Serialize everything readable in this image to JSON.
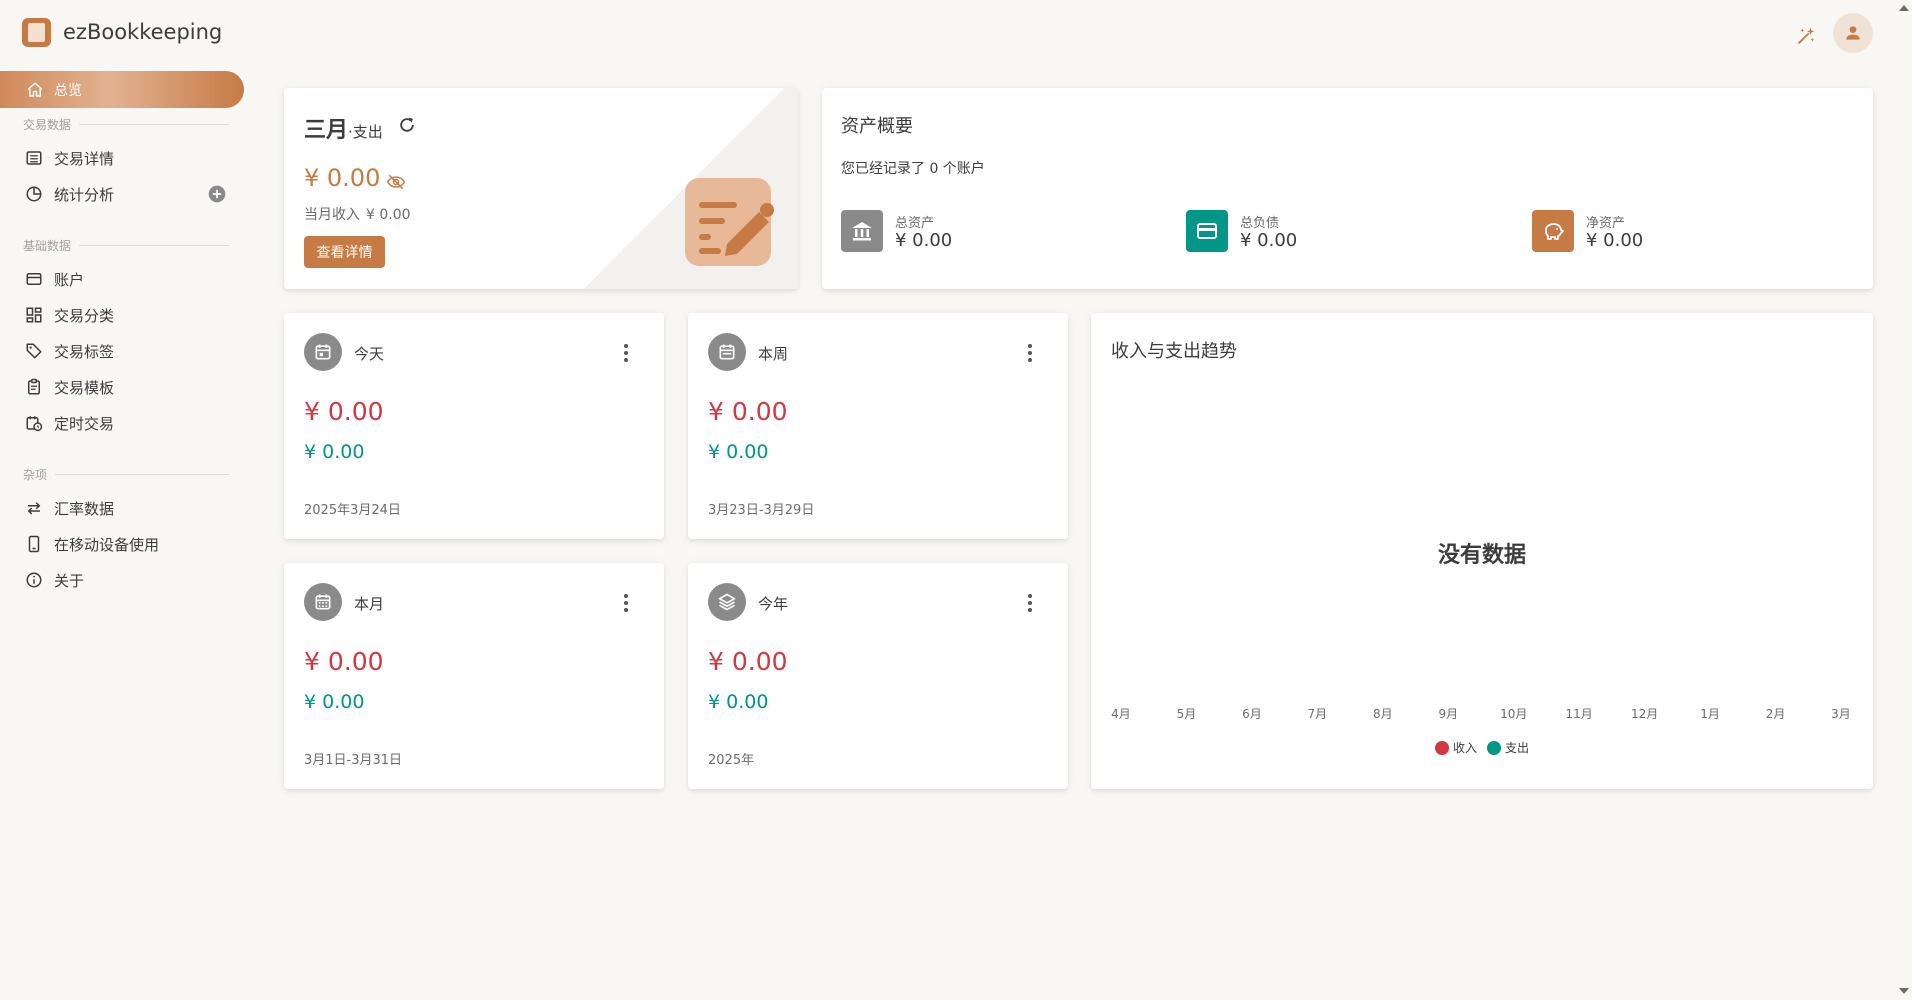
{
  "app": {
    "title": "ezBookkeeping"
  },
  "topbar": {
    "theme_icon": "magic-wand-icon",
    "avatar_icon": "user-icon"
  },
  "sidebar": {
    "active": {
      "label": "总览",
      "icon": "home-icon"
    },
    "sections": [
      {
        "title": "交易数据",
        "items": [
          {
            "label": "交易详情",
            "icon": "list-icon"
          },
          {
            "label": "统计分析",
            "icon": "pie-chart-icon"
          }
        ]
      },
      {
        "title": "基础数据",
        "items": [
          {
            "label": "账户",
            "icon": "credit-card-icon"
          },
          {
            "label": "交易分类",
            "icon": "grid-icon"
          },
          {
            "label": "交易标签",
            "icon": "tag-icon"
          },
          {
            "label": "交易模板",
            "icon": "clipboard-icon"
          },
          {
            "label": "定时交易",
            "icon": "calendar-clock-icon"
          }
        ]
      },
      {
        "title": "杂项",
        "items": [
          {
            "label": "汇率数据",
            "icon": "swap-icon"
          },
          {
            "label": "在移动设备使用",
            "icon": "phone-icon"
          },
          {
            "label": "关于",
            "icon": "info-icon"
          }
        ]
      }
    ]
  },
  "month_card": {
    "title": "三月",
    "subtitle": "·支出",
    "amount": "¥ 0.00",
    "income_label": "当月收入",
    "income_value": "¥ 0.00",
    "button": "查看详情"
  },
  "asset_card": {
    "title": "资产概要",
    "subtitle": "您已经记录了 0 个账户",
    "items": [
      {
        "label": "总资产",
        "value": "¥ 0.00",
        "color": "#8a8a8a",
        "icon": "bank-icon"
      },
      {
        "label": "总负债",
        "value": "¥ 0.00",
        "color": "#009688",
        "icon": "credit-card-icon"
      },
      {
        "label": "净资产",
        "value": "¥ 0.00",
        "color": "#c67b45",
        "icon": "piggy-bank-icon"
      }
    ]
  },
  "stats": [
    {
      "title": "今天",
      "expense": "¥ 0.00",
      "income": "¥ 0.00",
      "date": "2025年3月24日",
      "icon": "calendar-today-icon"
    },
    {
      "title": "本周",
      "expense": "¥ 0.00",
      "income": "¥ 0.00",
      "date": "3月23日-3月29日",
      "icon": "calendar-week-icon"
    },
    {
      "title": "本月",
      "expense": "¥ 0.00",
      "income": "¥ 0.00",
      "date": "3月1日-3月31日",
      "icon": "calendar-month-icon"
    },
    {
      "title": "今年",
      "expense": "¥ 0.00",
      "income": "¥ 0.00",
      "date": "2025年",
      "icon": "layers-icon"
    }
  ],
  "colors": {
    "accent": "#c67b45",
    "expense": "#d4373f",
    "income": "#009688"
  },
  "chart_data": {
    "type": "line",
    "title": "收入与支出趋势",
    "categories": [
      "4月",
      "5月",
      "6月",
      "7月",
      "8月",
      "9月",
      "10月",
      "11月",
      "12月",
      "1月",
      "2月",
      "3月"
    ],
    "series": [
      {
        "name": "收入",
        "color": "#d4373f",
        "values": []
      },
      {
        "name": "支出",
        "color": "#009688",
        "values": []
      }
    ],
    "empty_text": "没有数据",
    "legend": "bottom-center"
  }
}
